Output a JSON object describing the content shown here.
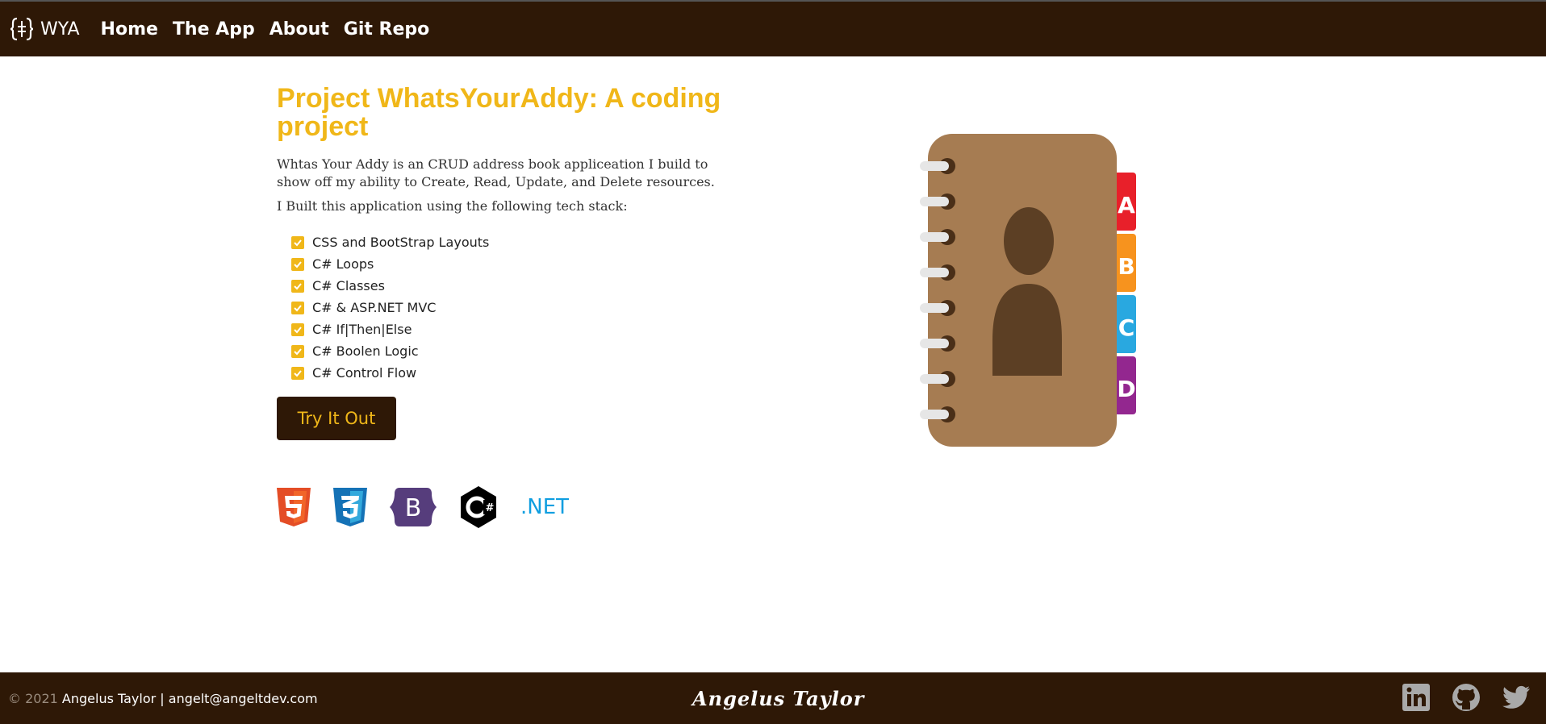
{
  "nav": {
    "brand_icon": "bracket-logo-icon",
    "brand": "WYA",
    "links": [
      "Home",
      "The App",
      "About",
      "Git Repo"
    ]
  },
  "main": {
    "title": "Project WhatsYourAddy: A coding project",
    "description": "Whtas Your Addy is an CRUD address book appliceation I build to show off my ability to Create, Read, Update, and Delete resources.",
    "stack_intro": "I Built this application using the following tech stack:",
    "stack": [
      "CSS and BootStrap Layouts",
      "C# Loops",
      "C# Classes",
      "C# & ASP.NET MVC",
      "C# If|Then|Else",
      "C# Boolen Logic",
      "C# Control Flow"
    ],
    "try_button": "Try It Out"
  },
  "tech_icons": [
    "html5-icon",
    "css3-icon",
    "bootstrap-icon",
    "csharp-icon"
  ],
  "tech_net_label": ".NET",
  "address_book": {
    "icon": "address-book-icon",
    "tabs": [
      "A",
      "B",
      "C",
      "D"
    ],
    "tab_colors": [
      "#e8202a",
      "#f7931e",
      "#29a8e0",
      "#93278f"
    ]
  },
  "footer": {
    "copyright_symbol_year": "© 2021",
    "author_info": "Angelus Taylor | angelt@angeltdev.com",
    "logo_text": "Angelus Taylor",
    "social_icons": [
      "linkedin-icon",
      "github-icon",
      "twitter-icon"
    ]
  },
  "colors": {
    "brand_dark": "#2e1806",
    "accent": "#f0b719",
    "book_cover": "#a67c52",
    "silhouette": "#5c3f24"
  }
}
